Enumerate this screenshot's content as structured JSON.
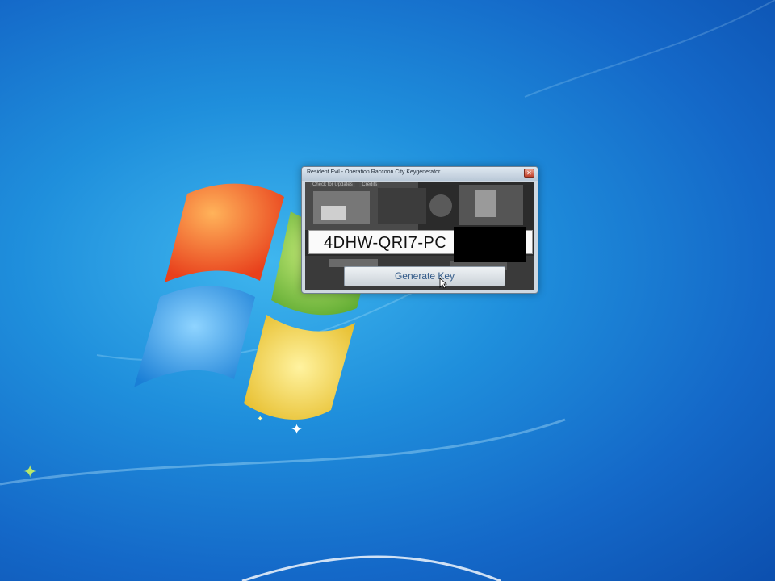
{
  "window": {
    "title": "Resident Evil - Operation Raccoon City Keygenerator",
    "close_glyph": "✕",
    "tabs": [
      "Check for Updates",
      "Credits"
    ]
  },
  "key_field": {
    "visible_value": "4DHW-QRI7-PC"
  },
  "generate_button": {
    "label": "Generate Key"
  },
  "colors": {
    "desktop_blue": "#1f8fdc",
    "logo_red": "#f2552a",
    "logo_green": "#7cc242",
    "logo_blue": "#2f9de8",
    "logo_yellow": "#f6d43a"
  }
}
